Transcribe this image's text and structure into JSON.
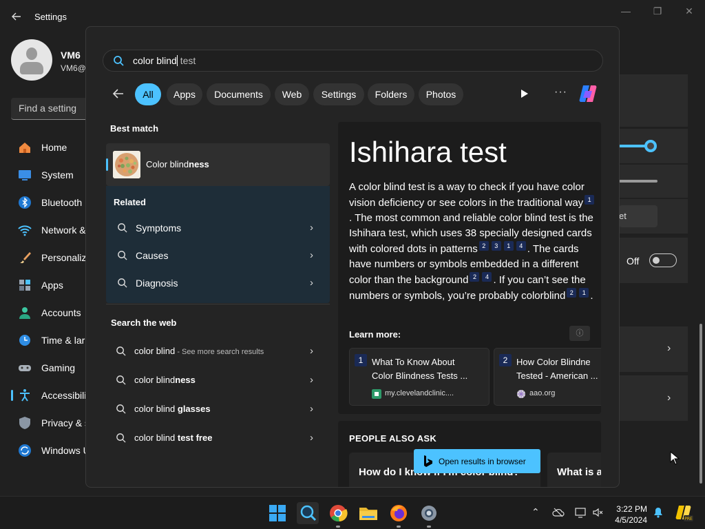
{
  "settings": {
    "title": "Settings",
    "user_name": "VM6",
    "user_email": "VM6@",
    "find_placeholder": "Find a setting",
    "nav": [
      {
        "label": "Home"
      },
      {
        "label": "System"
      },
      {
        "label": "Bluetooth"
      },
      {
        "label": "Network &"
      },
      {
        "label": "Personaliz"
      },
      {
        "label": "Apps"
      },
      {
        "label": "Accounts"
      },
      {
        "label": "Time & lar"
      },
      {
        "label": "Gaming"
      },
      {
        "label": "Accessibili"
      },
      {
        "label": "Privacy & s"
      },
      {
        "label": "Windows U"
      }
    ],
    "right": {
      "partial_button": "et",
      "toggle_label": "Off"
    }
  },
  "search": {
    "query_typed": "color blind",
    "query_ghost": " test",
    "filters": [
      "All",
      "Apps",
      "Documents",
      "Web",
      "Settings",
      "Folders",
      "Photos"
    ],
    "best_match_header": "Best match",
    "best_match": {
      "prefix": "Color blind",
      "bold": "ness"
    },
    "related_header": "Related",
    "related": [
      "Symptoms",
      "Causes",
      "Diagnosis"
    ],
    "web_header": "Search the web",
    "web": [
      {
        "prefix": "color blind",
        "bold": "",
        "hint": " - See more search results"
      },
      {
        "prefix": "color blind",
        "bold": "ness",
        "hint": ""
      },
      {
        "prefix": "color blind ",
        "bold": "glasses",
        "hint": ""
      },
      {
        "prefix": "color blind ",
        "bold": "test free",
        "hint": ""
      }
    ],
    "preview": {
      "title": "Ishihara test",
      "learn_more": "Learn more:",
      "cards": [
        {
          "num": "1",
          "line1": "What To Know About",
          "line2": "Color Blindness Tests ...",
          "domain": "my.clevelandclinic...."
        },
        {
          "num": "2",
          "line1": "How Color Blindne",
          "line2": "Tested - American ...",
          "domain": "aao.org"
        }
      ],
      "people_also_ask": "PEOPLE ALSO ASK",
      "questions": [
        "How do I know if I'm color blind?",
        "What is a"
      ]
    },
    "open_in_browser": "Open results in browser"
  },
  "taskbar": {
    "time": "3:22 PM",
    "date": "4/5/2024"
  },
  "colors": {
    "accent": "#4cc2ff",
    "panel": "#242424",
    "related_bg": "#1e2d38",
    "citation_bg": "#1a2a56"
  }
}
